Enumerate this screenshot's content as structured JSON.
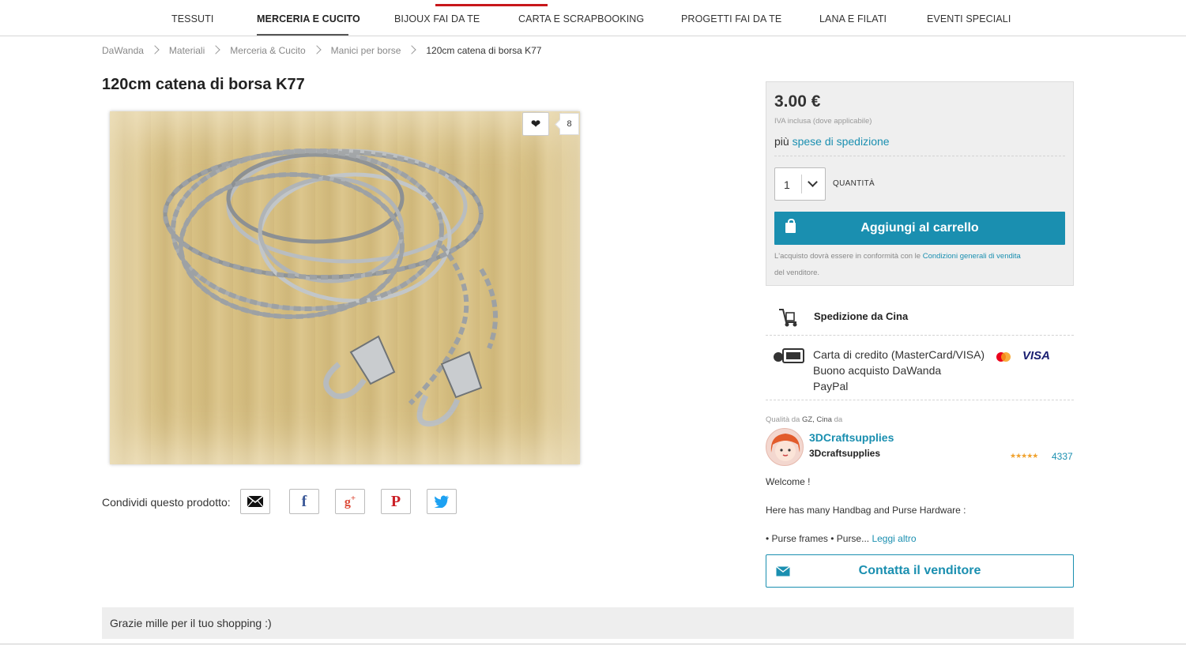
{
  "nav": {
    "items": [
      "TESSUTI",
      "MERCERIA E CUCITO",
      "BIJOUX FAI DA TE",
      "CARTA E SCRAPBOOKING",
      "PROGETTI FAI DA TE",
      "LANA E FILATI",
      "EVENTI SPECIALI"
    ],
    "active_index": 1,
    "accent_color": "#c8171b"
  },
  "breadcrumb": [
    "DaWanda",
    "Materiali",
    "Merceria & Cucito",
    "Manici per borse",
    "120cm catena di borsa K77"
  ],
  "product": {
    "title": "120cm catena di borsa K77",
    "favorite_count": "8",
    "image_subject": "silver chain with two swivel clasps on bamboo background"
  },
  "share": {
    "label": "Condividi questo prodotto:",
    "icons": [
      "email-icon",
      "facebook-icon",
      "google-plus-icon",
      "pinterest-icon",
      "twitter-icon"
    ]
  },
  "purchase": {
    "price": "3.00 €",
    "vat_note": "IVA inclusa (dove applicabile)",
    "shipping_prefix": "più",
    "shipping_link": "spese di spedizione",
    "quantity": "1",
    "quantity_label": "QUANTITÀ",
    "add_to_cart": "Aggiungi al carrello",
    "terms_prefix": "L'acquisto dovrà essere in conformità con le",
    "terms_link": "Condizioni generali di vendita",
    "terms_suffix": "del venditore.",
    "button_color": "#1a8fb0"
  },
  "shipping": {
    "text": "Spedizione da Cina"
  },
  "payment": {
    "methods": [
      "Carta di credito (MasterCard/VISA)",
      "Buono acquisto DaWanda",
      "PayPal"
    ],
    "visa_label": "VISA"
  },
  "seller": {
    "quality_prefix": "Qualità da",
    "location": "GZ, Cina",
    "quality_suffix": "da",
    "shop_name": "3DCraftsupplies",
    "username": "3Dcraftsupplies",
    "stars": "★★★★★",
    "rating_count": "4337",
    "desc_line1": "Welcome !",
    "desc_line2": "Here has many Handbag and Purse Hardware :",
    "desc_line3": "• Purse frames • Purse...",
    "read_more": "Leggi altro",
    "contact": "Contatta il venditore"
  },
  "footer_note": "Grazie mille per il tuo shopping :)"
}
